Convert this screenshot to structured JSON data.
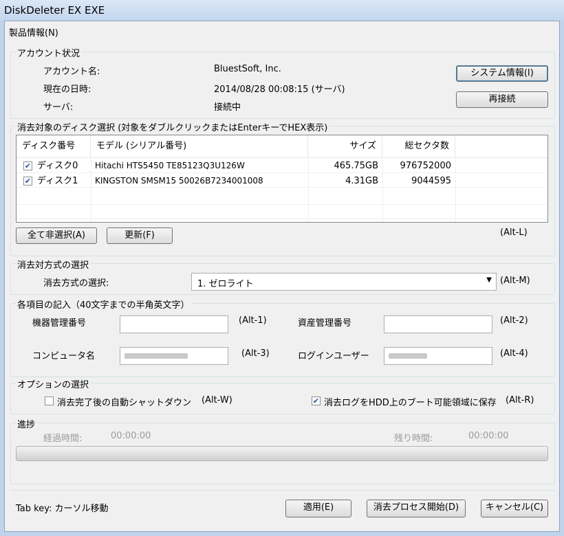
{
  "window": {
    "title": "DiskDeleter EX EXE"
  },
  "menu": {
    "product_info": "製品情報(N)"
  },
  "account": {
    "legend": "アカウント状況",
    "name_label": "アカウント名:",
    "name_value": "BluestSoft, Inc.",
    "datetime_label": "現在の日時:",
    "datetime_value": "2014/08/28  00:08:15 (サーバ)",
    "server_label": "サーバ:",
    "server_value": "接続中",
    "system_info_button": "システム情報(I)",
    "reconnect_button": "再接続"
  },
  "disk_select": {
    "legend": "消去対象のディスク選択 (対象をダブルクリックまたはEnterキーでHEX表示)",
    "columns": [
      "ディスク番号",
      "モデル (シリアル番号)",
      "サイズ",
      "総セクタ数"
    ],
    "rows": [
      {
        "checked": true,
        "disk": "ディスク0",
        "model": "Hitachi HTS5450 TE85123Q3U126W",
        "size": "465.75GB",
        "sectors": "976752000"
      },
      {
        "checked": true,
        "disk": "ディスク1",
        "model": "KINGSTON SMSM15 50026B7234001008",
        "size": "4.31GB",
        "sectors": "9044595"
      }
    ],
    "deselect_all_button": "全て非選択(A)",
    "refresh_button": "更新(F)",
    "shortcut": "(Alt-L)"
  },
  "method": {
    "legend": "消去対方式の選択",
    "label": "消去方式の選択:",
    "selected": "1. ゼロライト",
    "shortcut": "(Alt-M)"
  },
  "items": {
    "legend": "各項目の記入（40文字までの半角英文字）",
    "device_no_label": "機器管理番号",
    "device_no_value": "",
    "device_no_shortcut": "(Alt-1)",
    "asset_no_label": "資産管理番号",
    "asset_no_value": "",
    "asset_no_shortcut": "(Alt-2)",
    "computer_name_label": "コンピュータ名",
    "computer_name_shortcut": "(Alt-3)",
    "login_user_label": "ログインユーザー",
    "login_user_shortcut": "(Alt-4)"
  },
  "options": {
    "legend": "オプションの選択",
    "auto_shutdown_label": "消去完了後の自動シャットダウン",
    "auto_shutdown_shortcut": "(Alt-W)",
    "auto_shutdown_checked": false,
    "save_log_label": "消去ログをHDD上のブート可能領域に保存",
    "save_log_shortcut": "(Alt-R)",
    "save_log_checked": true
  },
  "progress": {
    "legend": "進捗",
    "elapsed_label": "経過時間:",
    "elapsed_value": "00:00:00",
    "remaining_label": "残り時間:",
    "remaining_value": "00:00:00",
    "fraction": 0
  },
  "footer": {
    "hint": "Tab key: カーソル移動",
    "apply_button": "適用(E)",
    "start_button": "消去プロセス開始(D)",
    "cancel_button": "キャンセル(C)"
  },
  "icons": {
    "check": "checkmark-icon",
    "dropdown": "triangle-down-icon"
  }
}
